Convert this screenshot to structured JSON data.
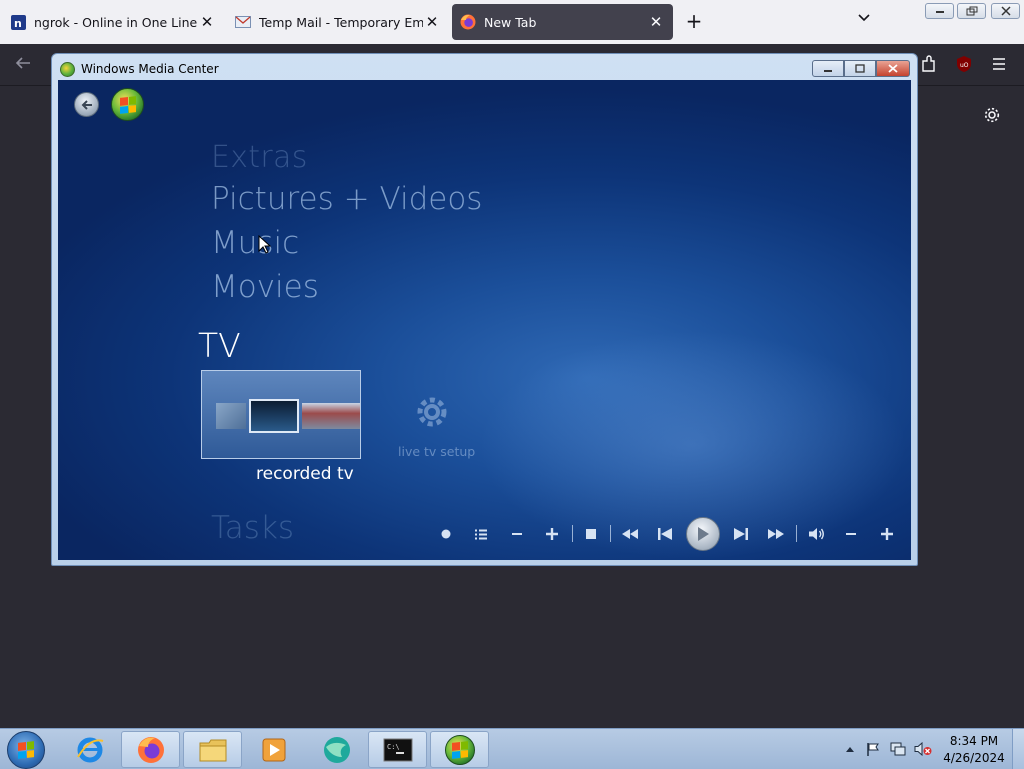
{
  "browser": {
    "tabs": [
      {
        "label": "ngrok - Online in One Line",
        "icon": "ngrok-icon",
        "active": false
      },
      {
        "label": "Temp Mail - Temporary Email",
        "icon": "mail-icon",
        "active": false
      },
      {
        "label": "New Tab",
        "icon": "firefox-icon",
        "active": true
      }
    ],
    "new_tab_label": "+",
    "close_glyph": "✕"
  },
  "wmc": {
    "title": "Windows Media Center",
    "menu": {
      "extras": "Extras",
      "pictures": "Pictures + Videos",
      "music": "Music",
      "movies": "Movies",
      "tv": "TV",
      "tasks": "Tasks"
    },
    "tiles": {
      "recorded": "recorded tv",
      "live_setup": "live tv setup"
    }
  },
  "taskbar": {
    "time": "8:34 PM",
    "date": "4/26/2024"
  },
  "colors": {
    "wmc_bg": "#1b4f9a",
    "tab_active": "#42414d",
    "taskbar": "#b7cbe4"
  }
}
